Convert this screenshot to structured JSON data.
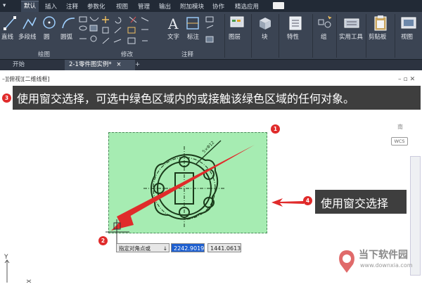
{
  "ribbon_tabs": [
    "默认",
    "插入",
    "注释",
    "参数化",
    "视图",
    "管理",
    "输出",
    "附加模块",
    "协作",
    "精选应用"
  ],
  "tools": {
    "line": "直线",
    "polyline": "多段线",
    "circle": "圆",
    "arc": "圆弧",
    "text": "文字",
    "dimension": "标注",
    "layers": "图层",
    "block": "块",
    "properties": "特性",
    "groups": "组",
    "utilities": "实用工具",
    "clipboard": "剪贴板",
    "view": "视图"
  },
  "groups": {
    "draw": "绘图",
    "modify": "修改",
    "annotation": "注释"
  },
  "file_tabs": {
    "start": "开始",
    "drawing": "2-1零件图实例*",
    "close": "×",
    "new": "+"
  },
  "viewport": {
    "label": "–][俯视][二维线框]",
    "controls": "–▫✕",
    "cube_label": "南",
    "wcs": "WCS",
    "axis_y": "Y"
  },
  "banner": {
    "badge": "3",
    "text": "使用窗交选择，可选中绿色区域内的或接触该绿色区域的任何对象。"
  },
  "callouts": {
    "one": "1",
    "two": "2",
    "four": "4",
    "side_text": "使用窗交选择"
  },
  "dynamic_input": {
    "prompt": "指定对角点或",
    "prompt_icon": "↓",
    "x_value": "2242.9019",
    "y_value": "1441.0613"
  },
  "watermark": {
    "name": "当下软件园",
    "url": "www.downxia.com"
  },
  "colors": {
    "selection_fill": "#a6ecb2",
    "arrow": "#e02b2b",
    "drawing_lines": "#1a3a1a"
  }
}
